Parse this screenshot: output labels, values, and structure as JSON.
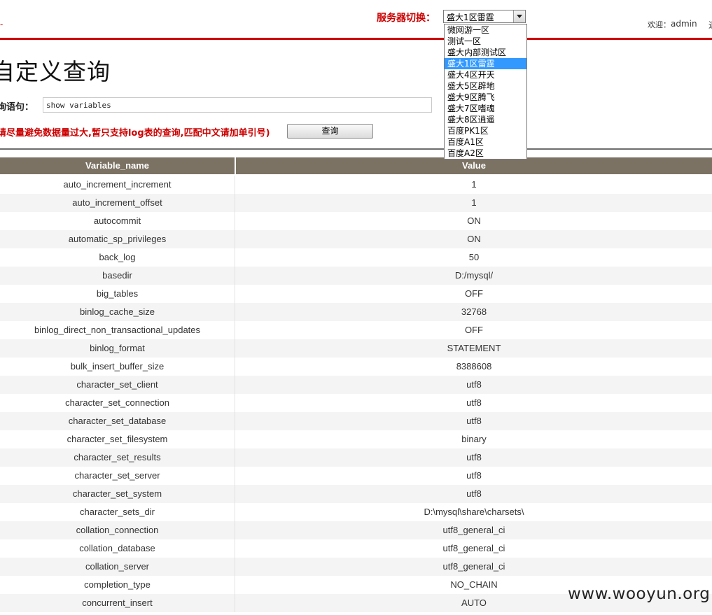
{
  "header": {
    "server_label": "服务器切换：",
    "selected_server": "盛大1区雷霆",
    "welcome_label": "欢迎：",
    "username": "admin",
    "cut_char": "退"
  },
  "server_options": [
    "微网游一区",
    "测试一区",
    "盛大内部测试区",
    "盛大1区雷霆",
    "盛大4区开天",
    "盛大5区辟地",
    "盛大9区腾飞",
    "盛大7区嗜魂",
    "盛大8区逍遥",
    "百度PK1区",
    "百度A1区",
    "百度A2区"
  ],
  "page": {
    "title": "自定义查询",
    "query_label": "询语句：",
    "query_value": "show variables",
    "notice": "请尽量避免数据量过大,暂只支持log表的查询,匹配中文请加单引号)",
    "query_button": "查询"
  },
  "table": {
    "columns": [
      "Variable_name",
      "Value"
    ],
    "rows": [
      [
        "auto_increment_increment",
        "1"
      ],
      [
        "auto_increment_offset",
        "1"
      ],
      [
        "autocommit",
        "ON"
      ],
      [
        "automatic_sp_privileges",
        "ON"
      ],
      [
        "back_log",
        "50"
      ],
      [
        "basedir",
        "D:/mysql/"
      ],
      [
        "big_tables",
        "OFF"
      ],
      [
        "binlog_cache_size",
        "32768"
      ],
      [
        "binlog_direct_non_transactional_updates",
        "OFF"
      ],
      [
        "binlog_format",
        "STATEMENT"
      ],
      [
        "bulk_insert_buffer_size",
        "8388608"
      ],
      [
        "character_set_client",
        "utf8"
      ],
      [
        "character_set_connection",
        "utf8"
      ],
      [
        "character_set_database",
        "utf8"
      ],
      [
        "character_set_filesystem",
        "binary"
      ],
      [
        "character_set_results",
        "utf8"
      ],
      [
        "character_set_server",
        "utf8"
      ],
      [
        "character_set_system",
        "utf8"
      ],
      [
        "character_sets_dir",
        "D:\\mysql\\share\\charsets\\"
      ],
      [
        "collation_connection",
        "utf8_general_ci"
      ],
      [
        "collation_database",
        "utf8_general_ci"
      ],
      [
        "collation_server",
        "utf8_general_ci"
      ],
      [
        "completion_type",
        "NO_CHAIN"
      ],
      [
        "concurrent_insert",
        "AUTO"
      ]
    ]
  },
  "watermark": "www.wooyun.org",
  "colors": {
    "accent_red": "#cc0000",
    "table_header": "#7b7263",
    "selected_option": "#3399ff"
  }
}
